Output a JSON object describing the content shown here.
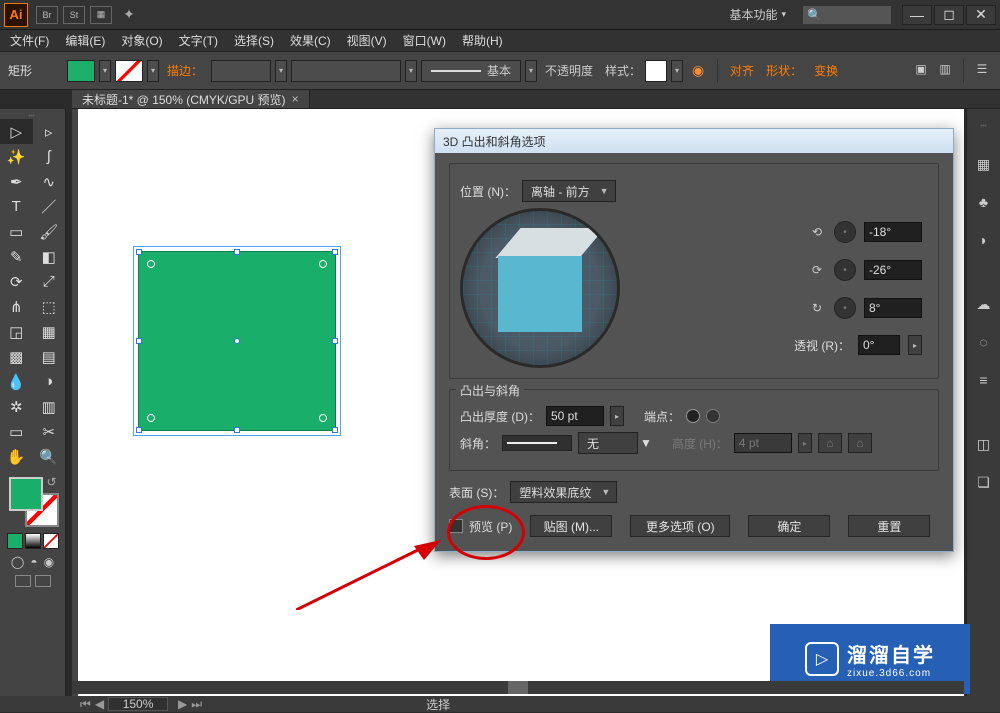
{
  "titlebar": {
    "logo": "Ai",
    "br": "Br",
    "st": "St",
    "workspace": "基本功能",
    "search_placeholder": "🔍"
  },
  "menu": {
    "file": "文件(F)",
    "edit": "编辑(E)",
    "object": "对象(O)",
    "type": "文字(T)",
    "select": "选择(S)",
    "effect": "效果(C)",
    "view": "视图(V)",
    "window": "窗口(W)",
    "help": "帮助(H)"
  },
  "options": {
    "shape": "矩形",
    "stroke": "描边：",
    "brush": "基本",
    "opacity": "不透明度",
    "style": "样式：",
    "align": "对齐",
    "shape2": "形状：",
    "transform": "变换"
  },
  "tab": {
    "title": "未标题-1* @ 150% (CMYK/GPU 预览)"
  },
  "dialog": {
    "title": "3D 凸出和斜角选项",
    "position_label": "位置 (N)：",
    "position_value": "离轴 - 前方",
    "rot_x": "-18°",
    "rot_y": "-26°",
    "rot_z": "8°",
    "perspective_label": "透视 (R)：",
    "perspective_value": "0°",
    "group2_title": "凸出与斜角",
    "depth_label": "凸出厚度 (D)：",
    "depth_value": "50 pt",
    "cap_label": "端点：",
    "bevel_label": "斜角：",
    "bevel_value": "无",
    "height_label": "高度 (H)：",
    "height_value": "4 pt",
    "surface_label": "表面 (S)：",
    "surface_value": "塑料效果底纹",
    "preview": "预览 (P)",
    "map": "贴图 (M)...",
    "more": "更多选项 (O)",
    "ok": "确定",
    "reset": "重置"
  },
  "status": {
    "zoom": "150%",
    "select": "选择"
  },
  "watermark": {
    "brand": "溜溜自学",
    "url": "zixue.3d66.com"
  },
  "chart_data": null
}
